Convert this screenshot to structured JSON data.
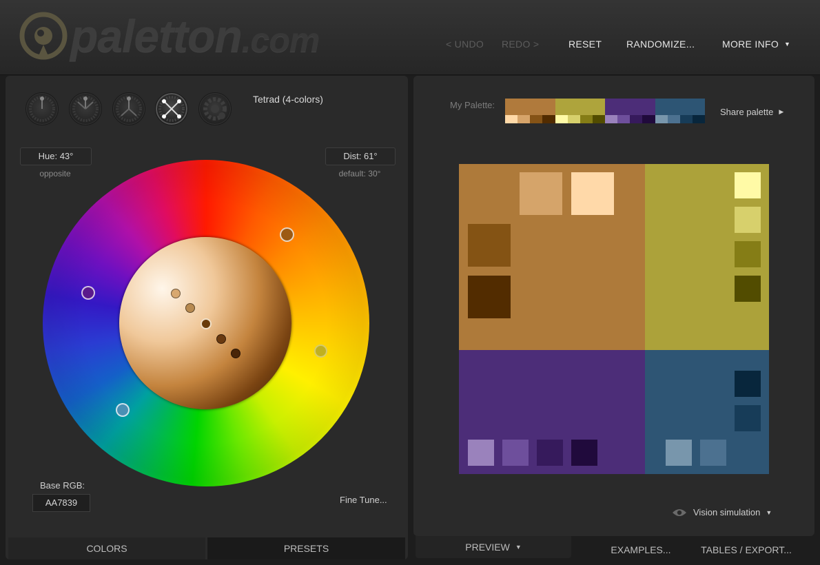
{
  "app": {
    "logo_text": "paletton",
    "logo_domain": ".com"
  },
  "nav": {
    "undo": "< UNDO",
    "redo": "REDO >",
    "reset": "RESET",
    "randomize": "RANDOMIZE...",
    "more_info": "MORE INFO"
  },
  "scheme": {
    "title": "Tetrad (4-colors)",
    "icons": [
      "mono-scheme-icon",
      "adjacent-scheme-icon",
      "triad-scheme-icon",
      "tetrad-scheme-icon",
      "free-style-scheme-icon"
    ],
    "active_index": 3
  },
  "hue": {
    "label": "Hue: 43°",
    "note": "opposite"
  },
  "dist": {
    "label": "Dist: 61°",
    "note": "default: 30°"
  },
  "base": {
    "label": "Base RGB:",
    "value": "AA7839"
  },
  "fine_tune": "Fine Tune...",
  "tabs": {
    "colors": "COLORS",
    "presets": "PRESETS",
    "preview": "PREVIEW",
    "examples": "EXAMPLES...",
    "tables": "TABLES / EXPORT..."
  },
  "my_palette": {
    "label": "My Palette:",
    "groups": [
      {
        "main": "#b07a3c",
        "shades": [
          "#ffd9a8",
          "#d6a46a",
          "#855316",
          "#522c00"
        ]
      },
      {
        "main": "#aea43c",
        "shades": [
          "#fffaa6",
          "#d7d06c",
          "#857d16",
          "#524c00"
        ]
      },
      {
        "main": "#4c2d78",
        "shades": [
          "#9a82bc",
          "#6e4f9c",
          "#361a5c",
          "#200a3c"
        ]
      },
      {
        "main": "#2d5574",
        "shades": [
          "#7896ac",
          "#4c7190",
          "#173c58",
          "#08263c"
        ]
      }
    ]
  },
  "share": "Share palette",
  "vision": "Vision simulation",
  "preview_colors": {
    "primary": "#ae7a3a",
    "secondary_a": "#aca23a",
    "secondary_b": "#4c2d78",
    "complement": "#2e5574",
    "primary_shades": [
      "#d5a46a",
      "#ffd9a9",
      "#845314",
      "#522c00"
    ],
    "secondary_a_shades": [
      "#fffaa6",
      "#d7d06c",
      "#857d16",
      "#524c00"
    ],
    "secondary_b_shades": [
      "#9a82bc",
      "#6e4f9c",
      "#361a5c",
      "#200a3c"
    ],
    "complement_shades": [
      "#08263c",
      "#173c58",
      "#7896ac",
      "#4c7190"
    ]
  }
}
